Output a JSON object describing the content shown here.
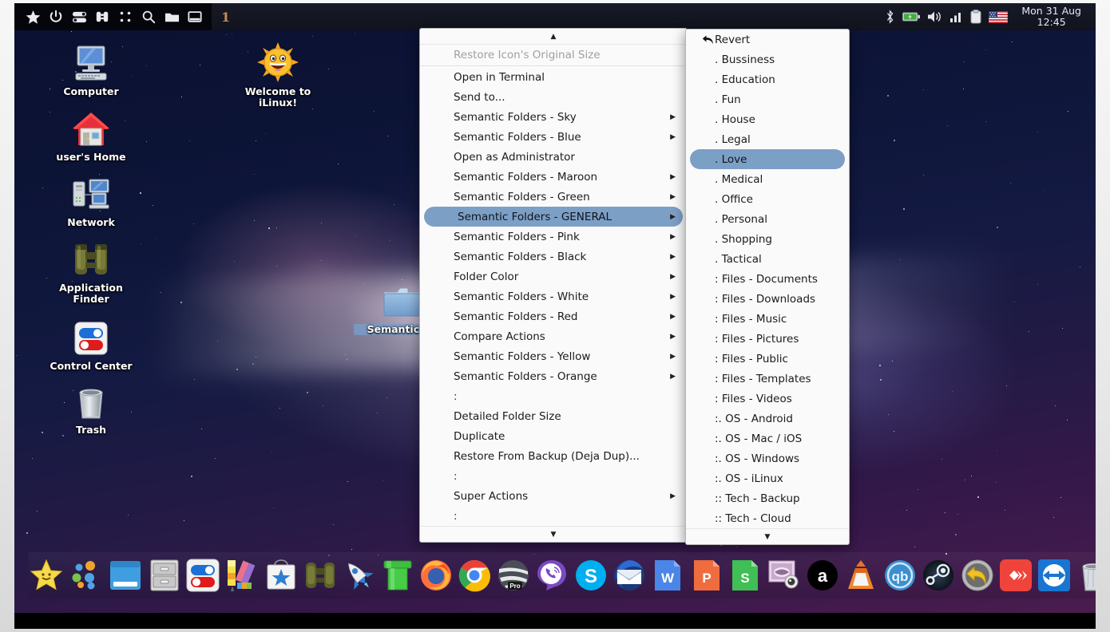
{
  "panel": {
    "launchers": [
      {
        "name": "star-icon",
        "label": "Favorites"
      },
      {
        "name": "power-icon",
        "label": "Power"
      },
      {
        "name": "toggles-icon",
        "label": "Control Center"
      },
      {
        "name": "binoculars-icon",
        "label": "Application Finder"
      },
      {
        "name": "grid-dots-icon",
        "label": "Applications Menu"
      },
      {
        "name": "search-icon",
        "label": "Search"
      },
      {
        "name": "folder-icon",
        "label": "File Manager"
      },
      {
        "name": "window-icon",
        "label": "Show Desktop"
      }
    ],
    "workspace": "1",
    "tray": [
      {
        "name": "bluetooth-icon",
        "label": "Bluetooth"
      },
      {
        "name": "battery-icon",
        "label": "Battery"
      },
      {
        "name": "volume-icon",
        "label": "Volume"
      },
      {
        "name": "network-signal-icon",
        "label": "Network"
      },
      {
        "name": "clipboard-icon",
        "label": "Clipboard"
      },
      {
        "name": "keyboard-layout-flag-icon",
        "label": "US"
      }
    ],
    "clock_date": "Mon 31 Aug",
    "clock_time": "12:45"
  },
  "desktop": {
    "icons": [
      {
        "label": "Computer",
        "icon": "computer-icon"
      },
      {
        "label": "user's Home",
        "icon": "home-icon"
      },
      {
        "label": "Network",
        "icon": "network-icon"
      },
      {
        "label": "Application Finder",
        "icon": "binoculars-icon"
      },
      {
        "label": "Control Center",
        "icon": "control-center-icon"
      },
      {
        "label": "Trash",
        "icon": "trash-icon"
      },
      {
        "label": "Welcome to iLinux!",
        "icon": "sun-smiley-icon"
      }
    ],
    "selected_folder": {
      "label": "Semantic Fol",
      "icon": "folder-icon"
    }
  },
  "context_menu": {
    "scroll_up": "▲",
    "scroll_down": "▼",
    "items": [
      {
        "label": "Restore Icon's Original Size",
        "type": "disabled"
      },
      {
        "label": "Open in Terminal",
        "type": "item"
      },
      {
        "label": "Send to...",
        "type": "item"
      },
      {
        "label": "Semantic Folders - Sky",
        "type": "submenu"
      },
      {
        "label": "Semantic Folders - Blue",
        "type": "submenu"
      },
      {
        "label": "Open as Administrator",
        "type": "item"
      },
      {
        "label": "Semantic Folders - Maroon",
        "type": "submenu"
      },
      {
        "label": "Semantic Folders - Green",
        "type": "submenu"
      },
      {
        "label": "Semantic Folders - GENERAL",
        "type": "submenu-selected"
      },
      {
        "label": "Semantic Folders - Pink",
        "type": "submenu"
      },
      {
        "label": "Semantic Folders - Black",
        "type": "submenu"
      },
      {
        "label": "Folder Color",
        "type": "submenu"
      },
      {
        "label": "Semantic Folders - White",
        "type": "submenu"
      },
      {
        "label": "Semantic Folders - Red",
        "type": "submenu"
      },
      {
        "label": "Compare Actions",
        "type": "submenu"
      },
      {
        "label": "Semantic Folders - Yellow",
        "type": "submenu"
      },
      {
        "label": "Semantic Folders - Orange",
        "type": "submenu"
      },
      {
        "label": ":",
        "type": "sep-row"
      },
      {
        "label": "Detailed Folder Size",
        "type": "item"
      },
      {
        "label": "Duplicate",
        "type": "item"
      },
      {
        "label": "Restore From Backup (Deja Dup)...",
        "type": "item"
      },
      {
        "label": ":",
        "type": "sep-row"
      },
      {
        "label": "Super Actions",
        "type": "submenu"
      },
      {
        "label": ":",
        "type": "sep-row"
      }
    ]
  },
  "submenu": {
    "scroll_down": "▼",
    "items": [
      {
        "label": "Revert",
        "type": "revert"
      },
      {
        "label": ". Bussiness",
        "type": "item"
      },
      {
        "label": ". Education",
        "type": "item"
      },
      {
        "label": ". Fun",
        "type": "item"
      },
      {
        "label": ". House",
        "type": "item"
      },
      {
        "label": ". Legal",
        "type": "item"
      },
      {
        "label": ". Love",
        "type": "selected"
      },
      {
        "label": ". Medical",
        "type": "item"
      },
      {
        "label": ". Office",
        "type": "item"
      },
      {
        "label": ". Personal",
        "type": "item"
      },
      {
        "label": ". Shopping",
        "type": "item"
      },
      {
        "label": ". Tactical",
        "type": "item"
      },
      {
        "label": ": Files - Documents",
        "type": "item"
      },
      {
        "label": ": Files - Downloads",
        "type": "item"
      },
      {
        "label": ": Files - Music",
        "type": "item"
      },
      {
        "label": ": Files - Pictures",
        "type": "item"
      },
      {
        "label": ": Files - Public",
        "type": "item"
      },
      {
        "label": ": Files - Templates",
        "type": "item"
      },
      {
        "label": ": Files - Videos",
        "type": "item"
      },
      {
        "label": ":. OS - Android",
        "type": "item"
      },
      {
        "label": ":. OS - Mac / iOS",
        "type": "item"
      },
      {
        "label": ":. OS - Windows",
        "type": "item"
      },
      {
        "label": ":. OS - iLinux",
        "type": "item"
      },
      {
        "label": ":: Tech - Backup",
        "type": "item"
      },
      {
        "label": ":: Tech - Cloud",
        "type": "item"
      }
    ]
  },
  "dock": {
    "items": [
      {
        "name": "star-smiley-icon",
        "label": "Favorites"
      },
      {
        "name": "app-menu-dots-icon",
        "label": "Applications"
      },
      {
        "name": "show-desktop-icon",
        "label": "Show Desktop"
      },
      {
        "name": "file-cabinet-icon",
        "label": "File Manager"
      },
      {
        "name": "control-center-icon",
        "label": "Control Center"
      },
      {
        "name": "color-palette-icon",
        "label": "Theme Settings"
      },
      {
        "name": "software-store-icon",
        "label": "Software Store"
      },
      {
        "name": "binoculars-icon",
        "label": "Application Finder"
      },
      {
        "name": "rocket-icon",
        "label": "Launcher"
      },
      {
        "name": "green-pipe-icon",
        "label": "Pipe"
      },
      {
        "name": "firefox-icon",
        "label": "Firefox"
      },
      {
        "name": "chrome-icon",
        "label": "Google Chrome"
      },
      {
        "name": "opera-pro-icon",
        "label": "Opera Pro"
      },
      {
        "name": "viber-icon",
        "label": "Viber"
      },
      {
        "name": "skype-icon",
        "label": "Skype"
      },
      {
        "name": "thunderbird-icon",
        "label": "Thunderbird"
      },
      {
        "name": "word-icon",
        "label": "Writer"
      },
      {
        "name": "presentation-icon",
        "label": "Impress"
      },
      {
        "name": "spreadsheet-icon",
        "label": "Calc"
      },
      {
        "name": "image-viewer-icon",
        "label": "Image Viewer"
      },
      {
        "name": "amazon-icon",
        "label": "Amazon"
      },
      {
        "name": "vlc-icon",
        "label": "VLC Media Player"
      },
      {
        "name": "qbittorrent-icon",
        "label": "qBittorrent"
      },
      {
        "name": "steam-icon",
        "label": "Steam"
      },
      {
        "name": "timeshift-icon",
        "label": "Timeshift"
      },
      {
        "name": "anydesk-icon",
        "label": "AnyDesk"
      },
      {
        "name": "teamviewer-icon",
        "label": "TeamViewer"
      },
      {
        "name": "trash-icon",
        "label": "Trash"
      }
    ]
  },
  "colors": {
    "menu_highlight": "#7c9fc6",
    "panel_bg": "#11131d",
    "accent": "#c58a52"
  }
}
